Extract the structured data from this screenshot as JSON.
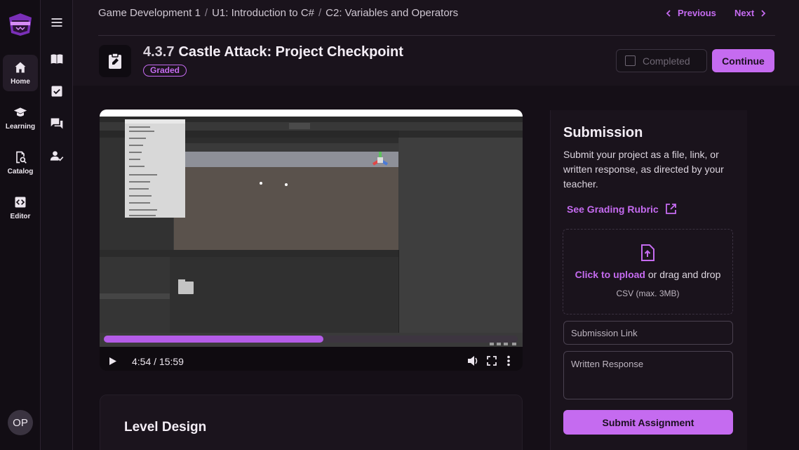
{
  "rail": {
    "items": [
      {
        "label": "Home",
        "icon": "home-icon"
      },
      {
        "label": "Learning",
        "icon": "graduation-cap-icon"
      },
      {
        "label": "Catalog",
        "icon": "catalog-search-icon"
      },
      {
        "label": "Editor",
        "icon": "code-editor-icon"
      }
    ],
    "avatar": "OP"
  },
  "breadcrumb": [
    "Game Development 1",
    "U1: Introduction to C#",
    "C2: Variables and Operators"
  ],
  "nav": {
    "previous": "Previous",
    "next": "Next"
  },
  "lesson": {
    "number": "4.3.7",
    "title": "Castle Attack: Project Checkpoint",
    "badge": "Graded",
    "completed_label": "Completed",
    "continue_label": "Continue"
  },
  "video": {
    "time": "4:54 / 15:59",
    "progress": 0.53
  },
  "level_design": {
    "title": "Level Design"
  },
  "submission": {
    "title": "Submission",
    "description": "Submit your project as a file, link, or written response, as directed by your teacher.",
    "rubric_label": "See Grading Rubric",
    "upload_link": "Click to upload",
    "upload_rest": " or drag and drop",
    "upload_hint": "CSV (max. 3MB)",
    "link_placeholder": "Submission Link",
    "response_placeholder": "Written Response",
    "submit_label": "Submit Assignment"
  },
  "colors": {
    "accent": "#c56bf0",
    "background": "#1a131c"
  }
}
